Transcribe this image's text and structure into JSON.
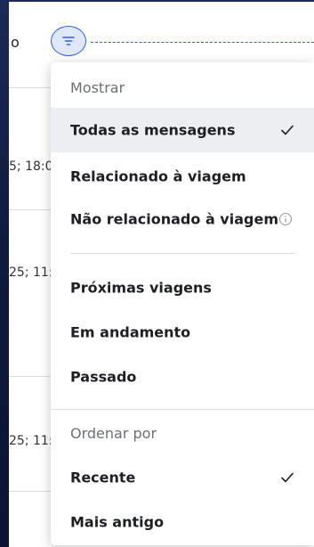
{
  "header": {
    "partial_text": "o",
    "filter_icon": "filter-icon"
  },
  "messages": [
    {
      "date_fragment": "5; 18:0"
    },
    {
      "date_fragment": "25; 11:"
    },
    {
      "date_fragment": "25; 11:"
    }
  ],
  "dropdown": {
    "show_section_label": "Mostrar",
    "items": [
      {
        "label": "Todas as mensagens",
        "selected": true
      },
      {
        "label": "Relacionado à viagem",
        "selected": false
      },
      {
        "label": "Não relacionado à viagem",
        "selected": false,
        "icon": "info-icon"
      },
      {
        "label": "Próximas viagens",
        "selected": false
      },
      {
        "label": "Em andamento",
        "selected": false
      },
      {
        "label": "Passado",
        "selected": false
      }
    ],
    "sort_section_label": "Ordenar por",
    "sort_items": [
      {
        "label": "Recente",
        "selected": true
      },
      {
        "label": "Mais antigo",
        "selected": false
      }
    ]
  },
  "colors": {
    "accent": "#2e5fe0",
    "navy": "#1b2a5a",
    "selected_bg": "#eceef2"
  }
}
